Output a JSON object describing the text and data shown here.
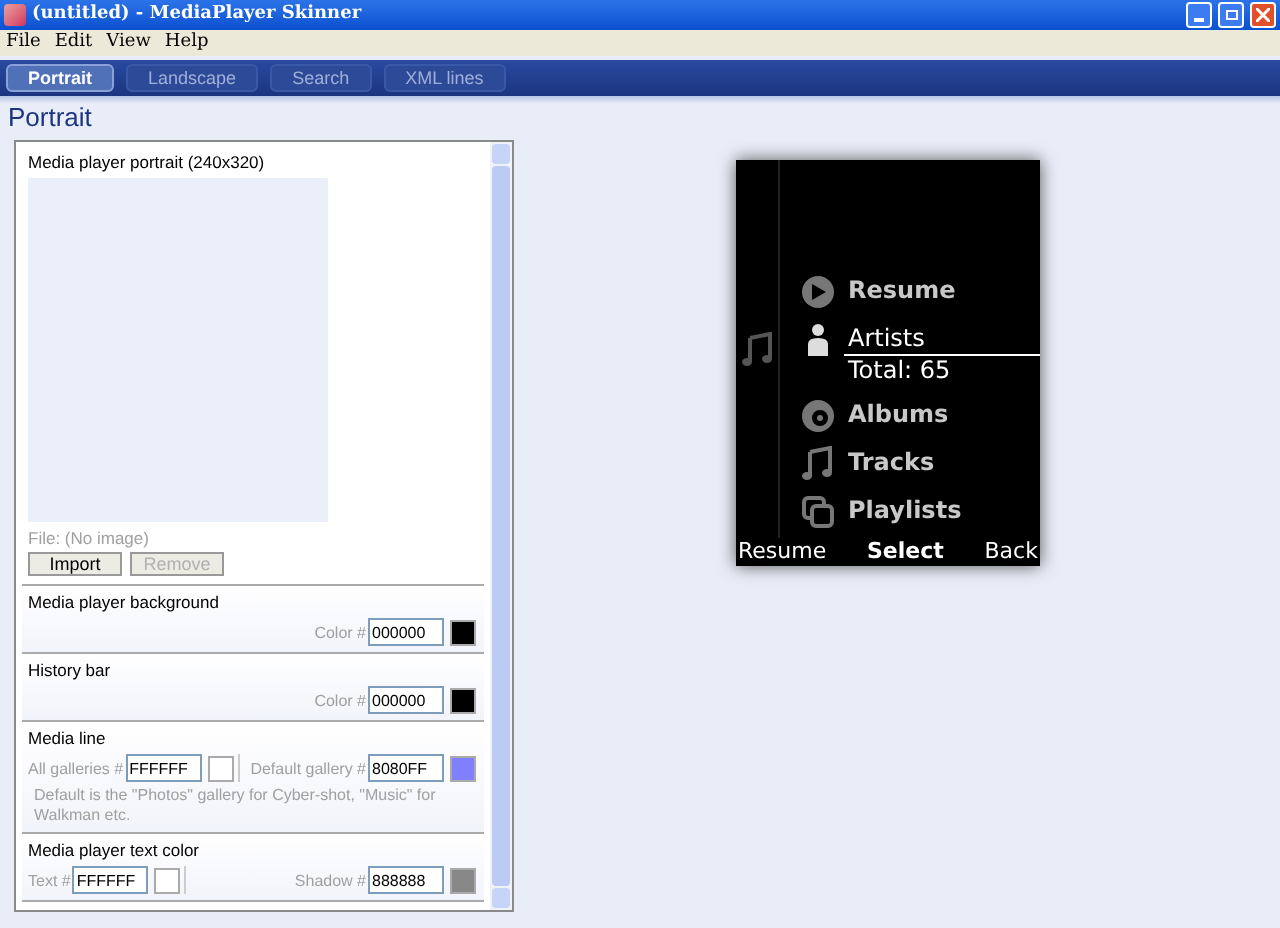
{
  "window": {
    "title": "(untitled) - MediaPlayer Skinner"
  },
  "menu": [
    "File",
    "Edit",
    "View",
    "Help"
  ],
  "tabs": [
    {
      "label": "Portrait",
      "selected": true
    },
    {
      "label": "Landscape",
      "selected": false
    },
    {
      "label": "Search",
      "selected": false
    },
    {
      "label": "XML lines",
      "selected": false
    }
  ],
  "heading": "Portrait",
  "sections": [
    {
      "kind": "image",
      "title": "Media player portrait (240x320)",
      "file": "File: (No image)",
      "buttons": [
        {
          "label": "Import",
          "disabled": false
        },
        {
          "label": "Remove",
          "disabled": true
        }
      ]
    },
    {
      "kind": "color",
      "title": "Media player background",
      "fields": [
        {
          "label": "Color #",
          "value": "000000",
          "color": "#000000"
        }
      ]
    },
    {
      "kind": "color",
      "title": "History bar",
      "fields": [
        {
          "label": "Color #",
          "value": "000000",
          "color": "#000000"
        }
      ]
    },
    {
      "kind": "color",
      "title": "Media line",
      "fields": [
        {
          "label": "All galleries #",
          "value": "FFFFFF",
          "color": "#ffffff"
        },
        {
          "label": "Default gallery #",
          "value": "8080FF",
          "color": "#8080ff"
        }
      ],
      "note": "Default is the \"Photos\" gallery for Cyber-shot, \"Music\" for Walkman etc."
    },
    {
      "kind": "color",
      "title": "Media player text color",
      "fields": [
        {
          "label": "Text #",
          "value": "FFFFFF",
          "color": "#ffffff"
        },
        {
          "label": "Shadow #",
          "value": "888888",
          "color": "#888888"
        }
      ]
    }
  ],
  "preview": {
    "items": [
      {
        "label": "Resume",
        "selected": false
      },
      {
        "label": "Artists",
        "subtitle": "Total: 65",
        "selected": true
      },
      {
        "label": "Albums",
        "selected": false
      },
      {
        "label": "Tracks",
        "selected": false
      },
      {
        "label": "Playlists",
        "selected": false
      }
    ],
    "softkeys": [
      "Resume",
      "Select",
      "Back"
    ]
  }
}
